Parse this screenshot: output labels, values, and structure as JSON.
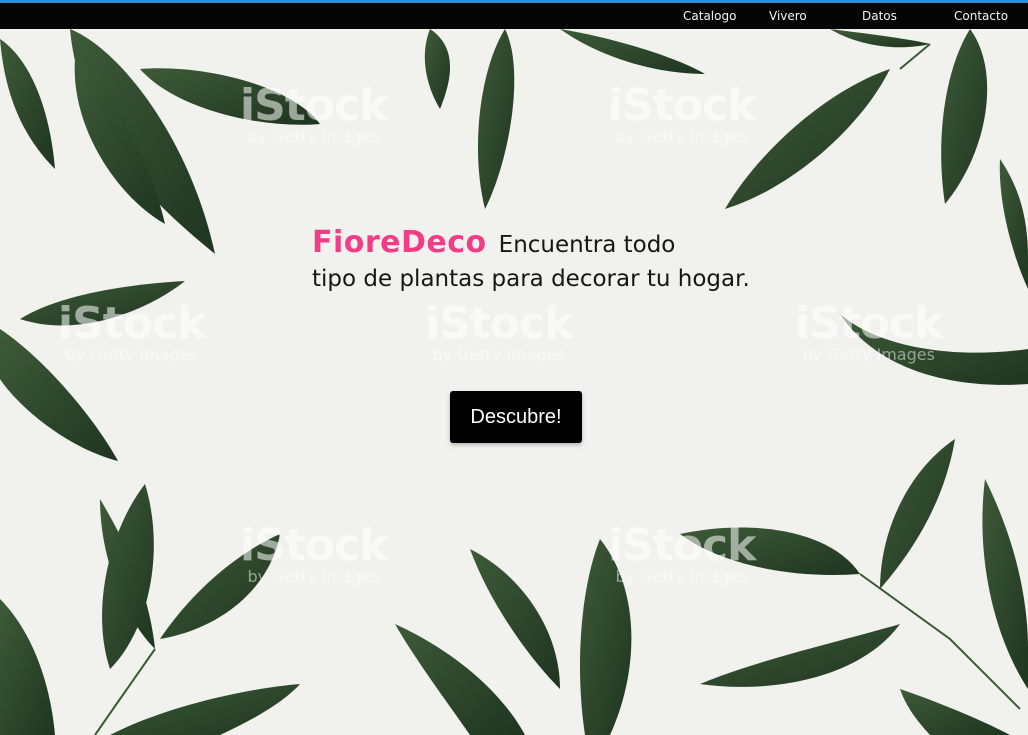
{
  "nav": {
    "items": [
      {
        "label": "Catalogo"
      },
      {
        "label": "Vivero"
      },
      {
        "label": "Datos"
      },
      {
        "label": "Contacto"
      }
    ]
  },
  "hero": {
    "brand": "FioreDeco",
    "tagline_line1": "Encuentra todo",
    "tagline_line2": "tipo de plantas para decorar tu hogar.",
    "cta_label": "Descubre!"
  },
  "watermark": {
    "main": "iStock",
    "sub": "by Getty Images"
  },
  "colors": {
    "brand": "#f23d86",
    "navbar": "#050505",
    "accent_line": "#2f8fd6",
    "leaf": "#2f4a2e",
    "background": "#f1f1ee"
  }
}
